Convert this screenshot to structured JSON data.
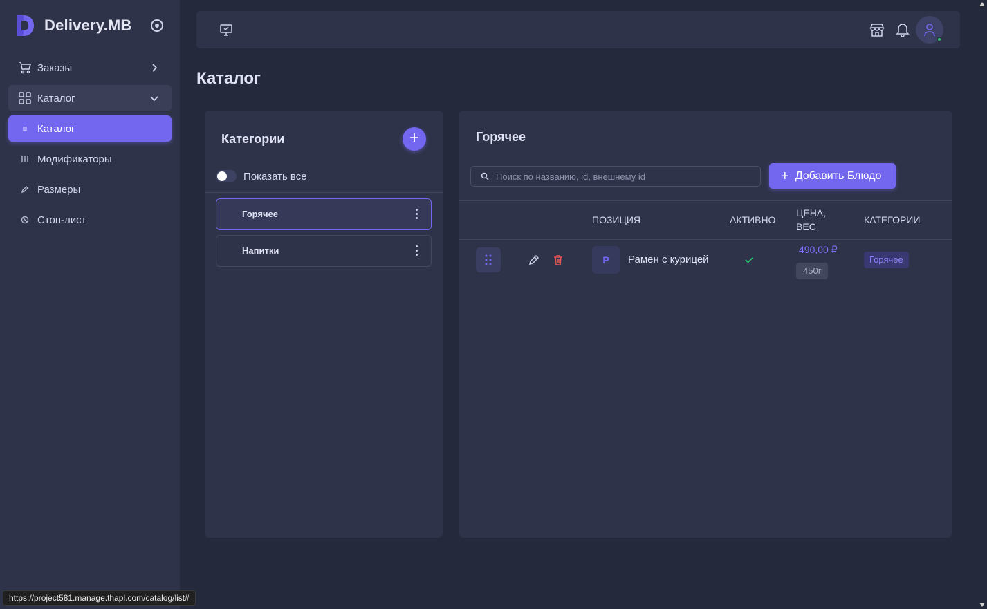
{
  "brand": {
    "name": "Delivery.MB",
    "accent": "#7367f0"
  },
  "sidebar": {
    "items": [
      {
        "label": "Заказы",
        "icon": "cart-icon"
      },
      {
        "label": "Каталог",
        "icon": "grid-icon"
      },
      {
        "label": "Каталог",
        "icon": "list-icon"
      },
      {
        "label": "Модификаторы",
        "icon": "sliders-icon"
      },
      {
        "label": "Размеры",
        "icon": "pencil-icon"
      },
      {
        "label": "Стоп-лист",
        "icon": "ban-icon"
      }
    ]
  },
  "page": {
    "title": "Каталог"
  },
  "categories": {
    "title": "Категории",
    "show_all_label": "Показать все",
    "items": [
      {
        "label": "Горячее"
      },
      {
        "label": "Напитки"
      }
    ]
  },
  "products": {
    "title": "Горячее",
    "search_placeholder": "Поиск по названию, id, внешнему id",
    "add_button": "Добавить Блюдо",
    "headers": {
      "position": "ПОЗИЦИЯ",
      "active": "АКТИВНО",
      "price_weight_1": "ЦЕНА,",
      "price_weight_2": "ВЕС",
      "categories": "КАТЕГОРИИ"
    },
    "rows": [
      {
        "avatar_letter": "Р",
        "name": "Рамен с курицей",
        "active": true,
        "price": "490,00 ₽",
        "weight": "450г",
        "category": "Горячее"
      }
    ]
  },
  "status_bar": {
    "url": "https://project581.manage.thapl.com/catalog/list#"
  }
}
